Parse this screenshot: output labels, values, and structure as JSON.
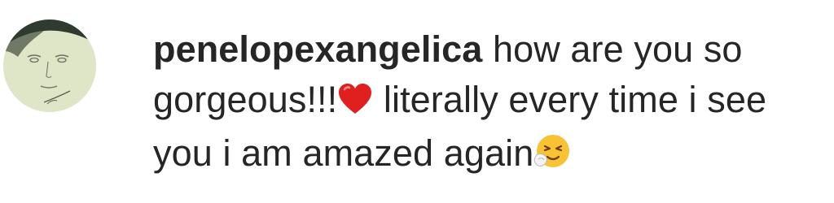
{
  "comment": {
    "username": "penelopexangelica",
    "text_part1": " how are you so gorgeous!!!",
    "emoji1": "red-heart-emoji",
    "text_part2": " literally every time i see you i am amazed again",
    "emoji2": "sneezing-face-emoji"
  },
  "colors": {
    "text": "#262626",
    "heart": "#e0201e",
    "avatar_bg": "#dfe6c8",
    "emoji_face": "#f7c332"
  }
}
